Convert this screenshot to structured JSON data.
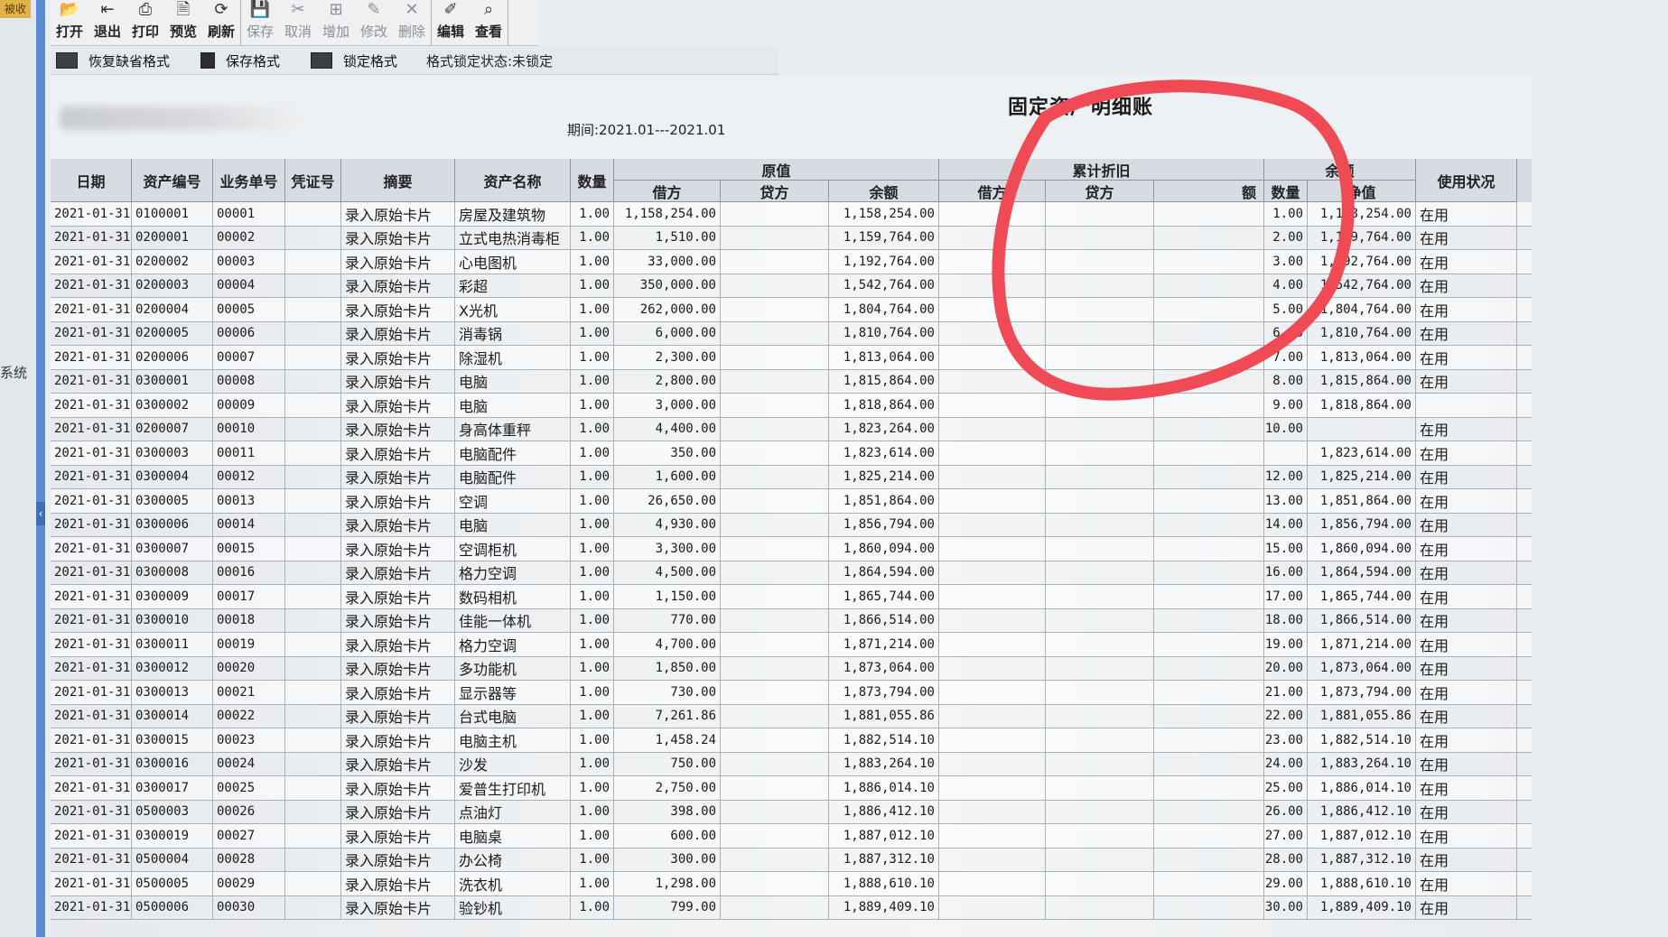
{
  "left_panel": {
    "corner_tab": "被收",
    "side_label": "系统"
  },
  "toolbar": {
    "groups": [
      [
        {
          "label": "打开",
          "icon": "open-icon"
        },
        {
          "label": "退出",
          "icon": "exit-icon"
        },
        {
          "label": "打印",
          "icon": "print-icon"
        },
        {
          "label": "预览",
          "icon": "preview-icon"
        },
        {
          "label": "刷新",
          "icon": "refresh-icon"
        }
      ],
      [
        {
          "label": "保存",
          "icon": "save-icon",
          "disabled": true
        },
        {
          "label": "取消",
          "icon": "cancel-icon",
          "disabled": true
        },
        {
          "label": "增加",
          "icon": "add-icon",
          "disabled": true
        },
        {
          "label": "修改",
          "icon": "modify-icon",
          "disabled": true
        },
        {
          "label": "删除",
          "icon": "delete-icon",
          "disabled": true
        }
      ],
      [
        {
          "label": "编辑",
          "icon": "edit-icon"
        },
        {
          "label": "查看",
          "icon": "view-icon"
        }
      ]
    ]
  },
  "format_bar": {
    "restore_default": "恢复缺省格式",
    "save_format": "保存格式",
    "lock_format": "锁定格式",
    "lock_status": "格式锁定状态:未锁定"
  },
  "report": {
    "title": "固定资产明细账",
    "period": "期间:2021.01---2021.01"
  },
  "table": {
    "headers": {
      "date": "日期",
      "asset_no": "资产编号",
      "biz_no": "业务单号",
      "voucher_no": "凭证号",
      "summary": "摘要",
      "asset_name": "资产名称",
      "qty": "数量",
      "original": "原值",
      "original_debit": "借方",
      "original_credit": "贷方",
      "original_balance": "余额",
      "depr": "累计折旧",
      "depr_debit": "借方",
      "depr_credit": "贷方",
      "depr_balance": "额",
      "balance": "余额",
      "balance_qty": "数量",
      "balance_net": "净值",
      "status": "使用状况"
    },
    "rows": [
      {
        "date": "2021-01-31",
        "asset_no": "0100001",
        "biz_no": "00001",
        "summary": "录入原始卡片",
        "name": "房屋及建筑物",
        "qty": "1.00",
        "debit": "1,158,254.00",
        "balance": "1,158,254.00",
        "bal_qty": "1.00",
        "net": "1,158,254.00",
        "status": "在用"
      },
      {
        "date": "2021-01-31",
        "asset_no": "0200001",
        "biz_no": "00002",
        "summary": "录入原始卡片",
        "name": "立式电热消毒柜",
        "qty": "1.00",
        "debit": "1,510.00",
        "balance": "1,159,764.00",
        "bal_qty": "2.00",
        "net": "1,159,764.00",
        "status": "在用"
      },
      {
        "date": "2021-01-31",
        "asset_no": "0200002",
        "biz_no": "00003",
        "summary": "录入原始卡片",
        "name": "心电图机",
        "qty": "1.00",
        "debit": "33,000.00",
        "balance": "1,192,764.00",
        "bal_qty": "3.00",
        "net": "1,192,764.00",
        "status": "在用"
      },
      {
        "date": "2021-01-31",
        "asset_no": "0200003",
        "biz_no": "00004",
        "summary": "录入原始卡片",
        "name": "彩超",
        "qty": "1.00",
        "debit": "350,000.00",
        "balance": "1,542,764.00",
        "bal_qty": "4.00",
        "net": "1,542,764.00",
        "status": "在用"
      },
      {
        "date": "2021-01-31",
        "asset_no": "0200004",
        "biz_no": "00005",
        "summary": "录入原始卡片",
        "name": "X光机",
        "qty": "1.00",
        "debit": "262,000.00",
        "balance": "1,804,764.00",
        "bal_qty": "5.00",
        "net": "1,804,764.00",
        "status": "在用"
      },
      {
        "date": "2021-01-31",
        "asset_no": "0200005",
        "biz_no": "00006",
        "summary": "录入原始卡片",
        "name": "消毒锅",
        "qty": "1.00",
        "debit": "6,000.00",
        "balance": "1,810,764.00",
        "bal_qty": "6.00",
        "net": "1,810,764.00",
        "status": "在用"
      },
      {
        "date": "2021-01-31",
        "asset_no": "0200006",
        "biz_no": "00007",
        "summary": "录入原始卡片",
        "name": "除湿机",
        "qty": "1.00",
        "debit": "2,300.00",
        "balance": "1,813,064.00",
        "bal_qty": "7.00",
        "net": "1,813,064.00",
        "status": "在用"
      },
      {
        "date": "2021-01-31",
        "asset_no": "0300001",
        "biz_no": "00008",
        "summary": "录入原始卡片",
        "name": "电脑",
        "qty": "1.00",
        "debit": "2,800.00",
        "balance": "1,815,864.00",
        "bal_qty": "8.00",
        "net": "1,815,864.00",
        "status": "在用"
      },
      {
        "date": "2021-01-31",
        "asset_no": "0300002",
        "biz_no": "00009",
        "summary": "录入原始卡片",
        "name": "电脑",
        "qty": "1.00",
        "debit": "3,000.00",
        "balance": "1,818,864.00",
        "bal_qty": "9.00",
        "net": "1,818,864.00",
        "status": ""
      },
      {
        "date": "2021-01-31",
        "asset_no": "0200007",
        "biz_no": "00010",
        "summary": "录入原始卡片",
        "name": "身高体重秤",
        "qty": "1.00",
        "debit": "4,400.00",
        "balance": "1,823,264.00",
        "bal_qty": "10.00",
        "net": "",
        "status": "在用"
      },
      {
        "date": "2021-01-31",
        "asset_no": "0300003",
        "biz_no": "00011",
        "summary": "录入原始卡片",
        "name": "电脑配件",
        "qty": "1.00",
        "debit": "350.00",
        "balance": "1,823,614.00",
        "bal_qty": "",
        "net": "1,823,614.00",
        "status": "在用"
      },
      {
        "date": "2021-01-31",
        "asset_no": "0300004",
        "biz_no": "00012",
        "summary": "录入原始卡片",
        "name": "电脑配件",
        "qty": "1.00",
        "debit": "1,600.00",
        "balance": "1,825,214.00",
        "bal_qty": "12.00",
        "net": "1,825,214.00",
        "status": "在用"
      },
      {
        "date": "2021-01-31",
        "asset_no": "0300005",
        "biz_no": "00013",
        "summary": "录入原始卡片",
        "name": "空调",
        "qty": "1.00",
        "debit": "26,650.00",
        "balance": "1,851,864.00",
        "bal_qty": "13.00",
        "net": "1,851,864.00",
        "status": "在用"
      },
      {
        "date": "2021-01-31",
        "asset_no": "0300006",
        "biz_no": "00014",
        "summary": "录入原始卡片",
        "name": "电脑",
        "qty": "1.00",
        "debit": "4,930.00",
        "balance": "1,856,794.00",
        "bal_qty": "14.00",
        "net": "1,856,794.00",
        "status": "在用"
      },
      {
        "date": "2021-01-31",
        "asset_no": "0300007",
        "biz_no": "00015",
        "summary": "录入原始卡片",
        "name": "空调柜机",
        "qty": "1.00",
        "debit": "3,300.00",
        "balance": "1,860,094.00",
        "bal_qty": "15.00",
        "net": "1,860,094.00",
        "status": "在用"
      },
      {
        "date": "2021-01-31",
        "asset_no": "0300008",
        "biz_no": "00016",
        "summary": "录入原始卡片",
        "name": "格力空调",
        "qty": "1.00",
        "debit": "4,500.00",
        "balance": "1,864,594.00",
        "bal_qty": "16.00",
        "net": "1,864,594.00",
        "status": "在用"
      },
      {
        "date": "2021-01-31",
        "asset_no": "0300009",
        "biz_no": "00017",
        "summary": "录入原始卡片",
        "name": "数码相机",
        "qty": "1.00",
        "debit": "1,150.00",
        "balance": "1,865,744.00",
        "bal_qty": "17.00",
        "net": "1,865,744.00",
        "status": "在用"
      },
      {
        "date": "2021-01-31",
        "asset_no": "0300010",
        "biz_no": "00018",
        "summary": "录入原始卡片",
        "name": "佳能一体机",
        "qty": "1.00",
        "debit": "770.00",
        "balance": "1,866,514.00",
        "bal_qty": "18.00",
        "net": "1,866,514.00",
        "status": "在用"
      },
      {
        "date": "2021-01-31",
        "asset_no": "0300011",
        "biz_no": "00019",
        "summary": "录入原始卡片",
        "name": "格力空调",
        "qty": "1.00",
        "debit": "4,700.00",
        "balance": "1,871,214.00",
        "bal_qty": "19.00",
        "net": "1,871,214.00",
        "status": "在用"
      },
      {
        "date": "2021-01-31",
        "asset_no": "0300012",
        "biz_no": "00020",
        "summary": "录入原始卡片",
        "name": "多功能机",
        "qty": "1.00",
        "debit": "1,850.00",
        "balance": "1,873,064.00",
        "bal_qty": "20.00",
        "net": "1,873,064.00",
        "status": "在用"
      },
      {
        "date": "2021-01-31",
        "asset_no": "0300013",
        "biz_no": "00021",
        "summary": "录入原始卡片",
        "name": "显示器等",
        "qty": "1.00",
        "debit": "730.00",
        "balance": "1,873,794.00",
        "bal_qty": "21.00",
        "net": "1,873,794.00",
        "status": "在用"
      },
      {
        "date": "2021-01-31",
        "asset_no": "0300014",
        "biz_no": "00022",
        "summary": "录入原始卡片",
        "name": "台式电脑",
        "qty": "1.00",
        "debit": "7,261.86",
        "balance": "1,881,055.86",
        "bal_qty": "22.00",
        "net": "1,881,055.86",
        "status": "在用"
      },
      {
        "date": "2021-01-31",
        "asset_no": "0300015",
        "biz_no": "00023",
        "summary": "录入原始卡片",
        "name": "电脑主机",
        "qty": "1.00",
        "debit": "1,458.24",
        "balance": "1,882,514.10",
        "bal_qty": "23.00",
        "net": "1,882,514.10",
        "status": "在用"
      },
      {
        "date": "2021-01-31",
        "asset_no": "0300016",
        "biz_no": "00024",
        "summary": "录入原始卡片",
        "name": "沙发",
        "qty": "1.00",
        "debit": "750.00",
        "balance": "1,883,264.10",
        "bal_qty": "24.00",
        "net": "1,883,264.10",
        "status": "在用"
      },
      {
        "date": "2021-01-31",
        "asset_no": "0300017",
        "biz_no": "00025",
        "summary": "录入原始卡片",
        "name": "爱普生打印机",
        "qty": "1.00",
        "debit": "2,750.00",
        "balance": "1,886,014.10",
        "bal_qty": "25.00",
        "net": "1,886,014.10",
        "status": "在用"
      },
      {
        "date": "2021-01-31",
        "asset_no": "0500003",
        "biz_no": "00026",
        "summary": "录入原始卡片",
        "name": "点油灯",
        "qty": "1.00",
        "debit": "398.00",
        "balance": "1,886,412.10",
        "bal_qty": "26.00",
        "net": "1,886,412.10",
        "status": "在用"
      },
      {
        "date": "2021-01-31",
        "asset_no": "0300019",
        "biz_no": "00027",
        "summary": "录入原始卡片",
        "name": "电脑桌",
        "qty": "1.00",
        "debit": "600.00",
        "balance": "1,887,012.10",
        "bal_qty": "27.00",
        "net": "1,887,012.10",
        "status": "在用"
      },
      {
        "date": "2021-01-31",
        "asset_no": "0500004",
        "biz_no": "00028",
        "summary": "录入原始卡片",
        "name": "办公椅",
        "qty": "1.00",
        "debit": "300.00",
        "balance": "1,887,312.10",
        "bal_qty": "28.00",
        "net": "1,887,312.10",
        "status": "在用"
      },
      {
        "date": "2021-01-31",
        "asset_no": "0500005",
        "biz_no": "00029",
        "summary": "录入原始卡片",
        "name": "洗衣机",
        "qty": "1.00",
        "debit": "1,298.00",
        "balance": "1,888,610.10",
        "bal_qty": "29.00",
        "net": "1,888,610.10",
        "status": "在用"
      },
      {
        "date": "2021-01-31",
        "asset_no": "0500006",
        "biz_no": "00030",
        "summary": "录入原始卡片",
        "name": "验钞机",
        "qty": "1.00",
        "debit": "799.00",
        "balance": "1,889,409.10",
        "bal_qty": "30.00",
        "net": "1,889,409.10",
        "status": "在用"
      }
    ]
  },
  "colors": {
    "annotation_circle": "#f04a55",
    "collapse_bar": "#5a8bd0"
  }
}
